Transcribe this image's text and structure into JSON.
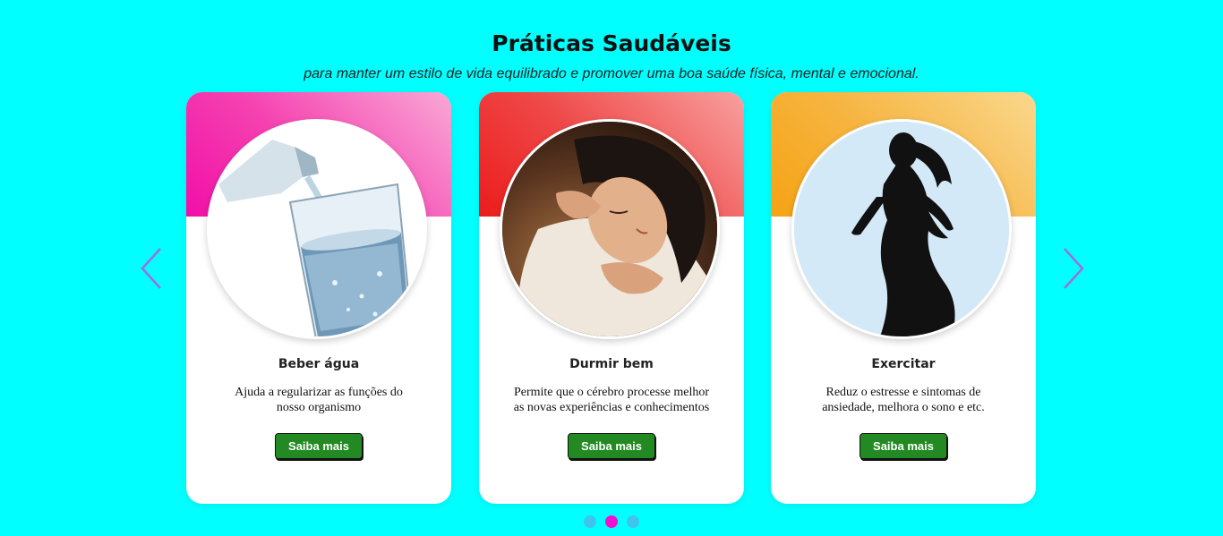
{
  "header": {
    "title": "Práticas Saudáveis",
    "subtitle": "para manter um estilo de vida equilibrado e promover uma boa saúde física, mental e emocional."
  },
  "cards": [
    {
      "title": "Beber água",
      "text": "Ajuda a regularizar as funções do nosso organismo",
      "button_label": "Saiba mais",
      "accent_color": "#f20fa8",
      "image_icon": "water-glass-image"
    },
    {
      "title": "Durmir bem",
      "text": "Permite que o cérebro processe melhor as novas experiências e conhecimentos",
      "button_label": "Saiba mais",
      "accent_color": "#ec1c1c",
      "image_icon": "sleeping-woman-image"
    },
    {
      "title": "Exercitar",
      "text": "Reduz o estresse e sintomas de ansiedade, melhora o sono e etc.",
      "button_label": "Saiba mais",
      "accent_color": "#f5a314",
      "image_icon": "running-woman-silhouette-image"
    }
  ],
  "carousel": {
    "prev_icon": "chevron-left-icon",
    "next_icon": "chevron-right-icon",
    "arrow_color": "#9b6fe0",
    "active_page": 2,
    "page_count": 3,
    "dot_color": "#3fc4f0",
    "dot_active_color": "#f20fd0"
  },
  "colors": {
    "background": "#00ffff",
    "button": "#238a23"
  }
}
